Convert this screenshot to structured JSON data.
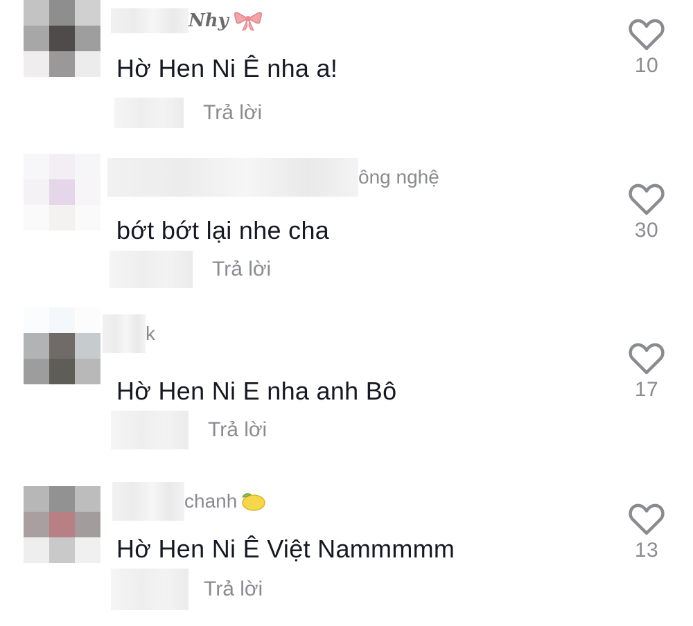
{
  "reply_label": "Trả lời",
  "colors": {
    "text": "#161823",
    "muted": "#8a8b91",
    "heart": "#8a8b91"
  },
  "comments": [
    {
      "username_suffix": "Nhy",
      "username_emoji": "bow-icon",
      "text": "Hờ Hen Ni Ê nha a!",
      "likes": "10"
    },
    {
      "username_suffix": "ông nghệ",
      "username_emoji": "",
      "text": "bớt bớt lại nhe cha",
      "likes": "30"
    },
    {
      "username_suffix": "k",
      "username_emoji": "",
      "text": "Hờ Hen Ni E nha anh Bô",
      "likes": "17"
    },
    {
      "username_suffix": "chanh",
      "username_emoji": "lemon-icon",
      "text": "Hờ Hen Ni Ê Việt Nammmmm",
      "likes": "13"
    }
  ]
}
